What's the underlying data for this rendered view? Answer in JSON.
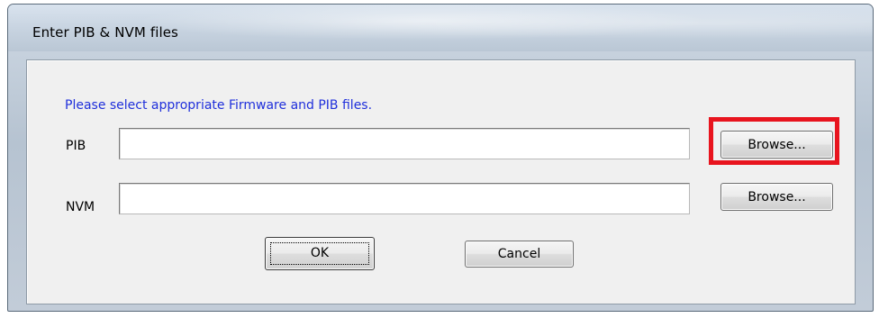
{
  "window": {
    "title": "Enter PIB & NVM files"
  },
  "dialog": {
    "instruction": "Please select appropriate Firmware and PIB files.",
    "pib": {
      "label": "PIB",
      "value": "",
      "browse_label": "Browse..."
    },
    "nvm": {
      "label": "NVM",
      "value": "",
      "browse_label": "Browse..."
    },
    "ok_label": "OK",
    "cancel_label": "Cancel"
  },
  "annotation": {
    "highlight_color": "#e8141e",
    "highlight_target": "pib-browse-button"
  },
  "colors": {
    "instruction_text": "#1f2fdb",
    "dialog_background": "#f0f0f0"
  }
}
